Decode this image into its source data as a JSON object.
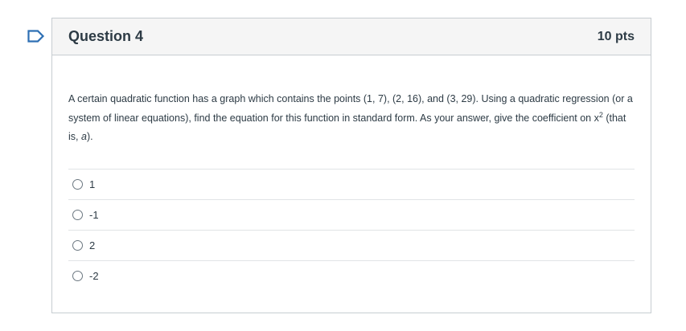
{
  "question": {
    "flag_icon": "bookmark-flag-icon",
    "title": "Question 4",
    "points": "10 pts",
    "text_before_sup": "A certain quadratic function has a graph which contains the points (1, 7), (2, 16), and (3, 29). Using a quadratic regression (or a system of linear equations), find the equation for this function in standard form. As your answer, give the coefficient on x",
    "superscript": "2",
    "text_after_sup": " (that is, ",
    "italic_var": "a",
    "text_end": ").",
    "answers": [
      {
        "label": "1",
        "selected": false
      },
      {
        "label": "-1",
        "selected": false
      },
      {
        "label": "2",
        "selected": false
      },
      {
        "label": "-2",
        "selected": false
      }
    ]
  },
  "colors": {
    "flag": "#2d6fb4",
    "header_bg": "#f5f5f5",
    "border": "#c7cdd1",
    "text": "#2d3b45"
  }
}
